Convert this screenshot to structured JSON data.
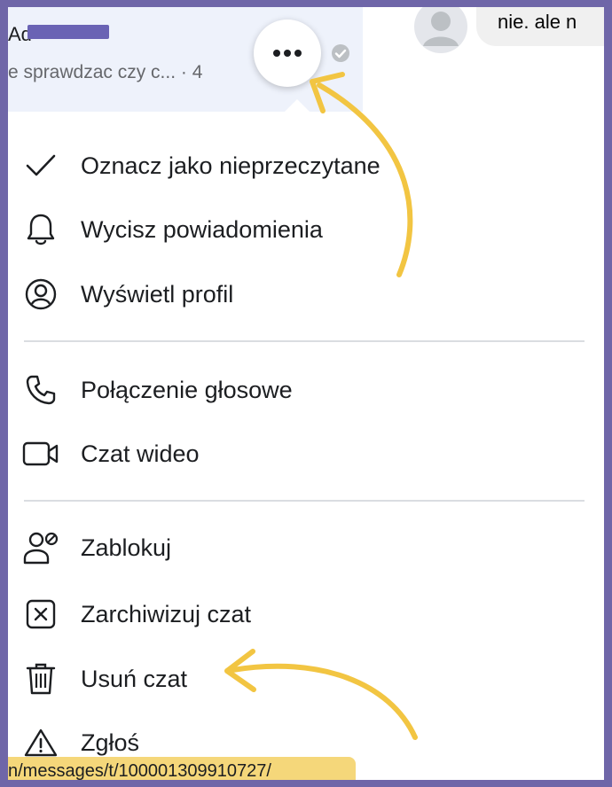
{
  "chat": {
    "name_visible": "Ad",
    "preview": "e sprawdzac czy c...",
    "preview_time": "· 4"
  },
  "right_pane": {
    "bubble_text": "nie. ale n"
  },
  "menu": {
    "items": [
      {
        "label": "Oznacz jako nieprzeczytane",
        "icon": "checkmark-icon"
      },
      {
        "label": "Wycisz powiadomienia",
        "icon": "bell-icon"
      },
      {
        "label": "Wyświetl profil",
        "icon": "profile-icon"
      },
      {
        "label": "Połączenie głosowe",
        "icon": "phone-icon"
      },
      {
        "label": "Czat wideo",
        "icon": "video-icon"
      },
      {
        "label": "Zablokuj",
        "icon": "block-user-icon"
      },
      {
        "label": "Zarchiwizuj czat",
        "icon": "archive-x-icon"
      },
      {
        "label": "Usuń czat",
        "icon": "trash-icon"
      },
      {
        "label": "Zgłoś",
        "icon": "warning-icon"
      }
    ]
  },
  "status_url": "n/messages/t/100001309910727/",
  "colors": {
    "frame": "#6f66a8",
    "annotation_arrow": "#f2c542",
    "status_bar": "#f5d77a"
  }
}
